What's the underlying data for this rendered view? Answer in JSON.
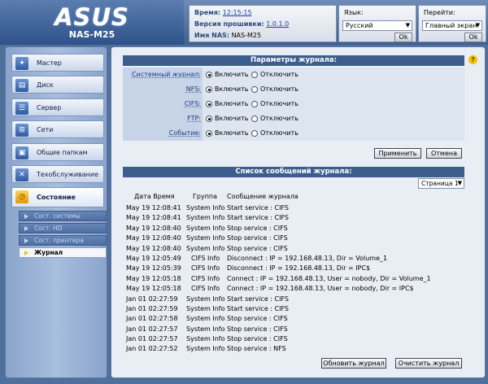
{
  "header": {
    "logo": "ASUS",
    "model": "NAS-M25",
    "time_label": "Время:",
    "time_value": "12:15:15",
    "firmware_label": "Версия прошивки:",
    "firmware_value": "1.0.1.0",
    "nas_name_label": "Имя NAS:",
    "nas_name_value": "NAS-M25",
    "lang_label": "Язык:",
    "lang_value": "Русский",
    "goto_label": "Перейти:",
    "goto_value": "Главный экран",
    "ok_label": "Ok"
  },
  "sidebar": {
    "items": [
      {
        "label": "Мастер",
        "icon": "wand-icon"
      },
      {
        "label": "Диск",
        "icon": "disk-icon"
      },
      {
        "label": "Сервер",
        "icon": "server-icon"
      },
      {
        "label": "Сети",
        "icon": "network-icon"
      },
      {
        "label": "Общие папкам",
        "icon": "shared-folder-icon"
      },
      {
        "label": "Техобслуживание",
        "icon": "tools-icon"
      },
      {
        "label": "Состояние",
        "icon": "status-icon"
      }
    ],
    "subitems": [
      {
        "label": "Сост. системы"
      },
      {
        "label": "Сост. HD"
      },
      {
        "label": "Сост. принтера"
      },
      {
        "label": "Журнал"
      }
    ]
  },
  "settings": {
    "title": "Параметры журнала:",
    "on_label": "Включить",
    "off_label": "Отключить",
    "rows": [
      {
        "label": "Системный журнал:",
        "state": "on"
      },
      {
        "label": "NFS:",
        "state": "on"
      },
      {
        "label": "CIFS:",
        "state": "on"
      },
      {
        "label": "FTP:",
        "state": "on"
      },
      {
        "label": "Событие:",
        "state": "on"
      }
    ],
    "apply_label": "Применить",
    "cancel_label": "Отмена"
  },
  "log": {
    "title": "Список сообщений журнала:",
    "page_select": "Страница 1",
    "columns": [
      "Дата Время",
      "Группа",
      "Сообщение журнала"
    ],
    "rows": [
      [
        "May 19 12:08:41",
        "System Info",
        "Start service : CIFS"
      ],
      [
        "May 19 12:08:41",
        "System Info",
        "Start service : CIFS"
      ],
      [
        "May 19 12:08:40",
        "System Info",
        "Stop service : CIFS"
      ],
      [
        "May 19 12:08:40",
        "System Info",
        "Stop service : CIFS"
      ],
      [
        "May 19 12:08:40",
        "System Info",
        "Stop service : CIFS"
      ],
      [
        "May 19 12:05:49",
        "CIFS Info",
        "Disconnect : IP = 192.168.48.13, Dir = Volume_1"
      ],
      [
        "May 19 12:05:39",
        "CIFS Info",
        "Disconnect : IP = 192.168.48.13, Dir = IPC$"
      ],
      [
        "May 19 12:05:18",
        "CIFS Info",
        "Connect : IP = 192.168.48.13, User = nobody, Dir = Volume_1"
      ],
      [
        "May 19 12:05:18",
        "CIFS Info",
        "Connect : IP = 192.168.48.13, User = nobody, Dir = IPC$"
      ],
      [
        "Jan 01 02:27:59",
        "System Info",
        "Start service : CIFS"
      ],
      [
        "Jan 01 02:27:59",
        "System Info",
        "Start service : CIFS"
      ],
      [
        "Jan 01 02:27:58",
        "System Info",
        "Stop service : CIFS"
      ],
      [
        "Jan 01 02:27:57",
        "System Info",
        "Stop service : CIFS"
      ],
      [
        "Jan 01 02:27:57",
        "System Info",
        "Stop service : CIFS"
      ],
      [
        "Jan 01 02:27:52",
        "System Info",
        "Stop service : NFS"
      ]
    ],
    "refresh_label": "Обновить журнал",
    "clear_label": "Очистить журнал"
  }
}
